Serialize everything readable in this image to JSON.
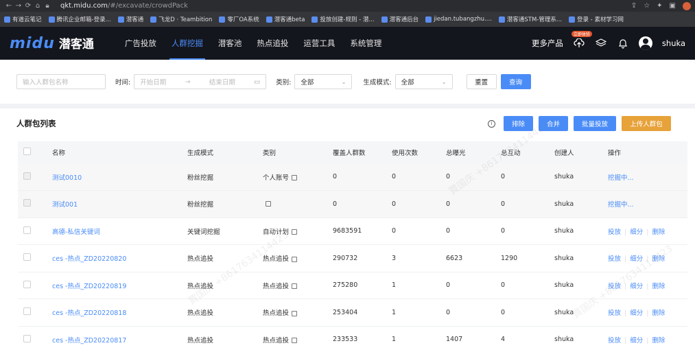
{
  "browser": {
    "url_host": "qkt.midu.com",
    "url_path": "/#/excavate/crowdPack",
    "bookmarks": [
      "有道云笔记",
      "腾讯企业邮箱-登录...",
      "潜客通",
      "飞龙D · Teambition",
      "零厂OA系统",
      "潜客通beta",
      "投放创建-规则 - 潜...",
      "潜客通后台",
      "jiedan.tubangzhu....",
      "潜客通STM-管理系...",
      "登录 - 素材学习网"
    ]
  },
  "header": {
    "brand": "midu",
    "brand_cn": "潜客通",
    "nav": [
      "广告投放",
      "人群挖掘",
      "潜客池",
      "热点追投",
      "运营工具",
      "系统管理"
    ],
    "active_nav": "人群挖掘",
    "more_products": "更多产品",
    "new_badge": "立即体验",
    "username": "shuka"
  },
  "filters": {
    "name_placeholder": "输入人群包名称",
    "time_label": "时间:",
    "start_placeholder": "开始日期",
    "range_arrow": "→",
    "end_placeholder": "结束日期",
    "category_label": "类别:",
    "category_value": "全部",
    "mode_label": "生成模式:",
    "mode_value": "全部",
    "reset": "重置",
    "query": "查询"
  },
  "list": {
    "title": "人群包列表",
    "actions": {
      "exclude": "排除",
      "merge": "合并",
      "batch": "批量投放",
      "upload": "上传人群包"
    },
    "columns": [
      "名称",
      "生成模式",
      "类别",
      "覆盖人群数",
      "使用次数",
      "总曝光",
      "总互动",
      "创建人",
      "操作"
    ],
    "rows": [
      {
        "name": "测试0010",
        "mode": "粉丝挖掘",
        "category": "个人账号",
        "coverage": "0",
        "uses": "0",
        "exposure": "0",
        "interact": "0",
        "creator": "shuka",
        "op1": "挖掘中...",
        "op2": "",
        "op3": ""
      },
      {
        "name": "测试001",
        "mode": "粉丝挖掘",
        "category": "",
        "coverage": "0",
        "uses": "0",
        "exposure": "0",
        "interact": "0",
        "creator": "shuka",
        "op1": "挖掘中...",
        "op2": "",
        "op3": ""
      },
      {
        "name": "高德-私信关键词",
        "mode": "关键词挖掘",
        "category": "自动计划",
        "coverage": "9683591",
        "uses": "0",
        "exposure": "0",
        "interact": "0",
        "creator": "shuka",
        "op1": "投放",
        "op2": "细分",
        "op3": "删除"
      },
      {
        "name": "ces -热点_ZD20220820",
        "mode": "热点追投",
        "category": "热点追投",
        "coverage": "290732",
        "uses": "3",
        "exposure": "6623",
        "interact": "1290",
        "creator": "shuka",
        "op1": "投放",
        "op2": "细分",
        "op3": "删除"
      },
      {
        "name": "ces -热点_ZD20220819",
        "mode": "热点追投",
        "category": "热点追投",
        "coverage": "275280",
        "uses": "1",
        "exposure": "0",
        "interact": "0",
        "creator": "shuka",
        "op1": "投放",
        "op2": "细分",
        "op3": "删除"
      },
      {
        "name": "ces -热点_ZD20220818",
        "mode": "热点追投",
        "category": "热点追投",
        "coverage": "253404",
        "uses": "1",
        "exposure": "0",
        "interact": "0",
        "creator": "shuka",
        "op1": "投放",
        "op2": "细分",
        "op3": "删除"
      },
      {
        "name": "ces -热点_ZD20220817",
        "mode": "热点追投",
        "category": "热点追投",
        "coverage": "233533",
        "uses": "1",
        "exposure": "1407",
        "interact": "4",
        "creator": "shuka",
        "op1": "投放",
        "op2": "细分",
        "op3": "删除"
      }
    ]
  },
  "colors": {
    "accent": "#4a8cf7",
    "header_bg": "#14161d",
    "upload": "#e7a23a"
  }
}
